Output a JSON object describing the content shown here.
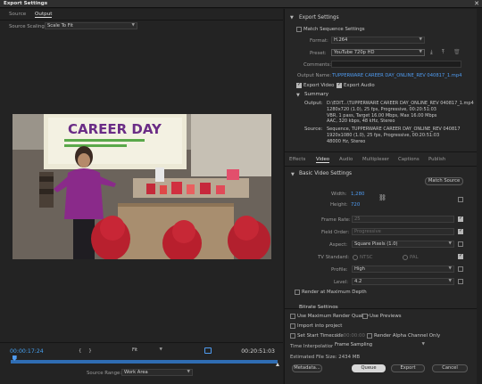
{
  "window": {
    "title": "Export Settings",
    "close": "✕"
  },
  "left": {
    "tabs": [
      "Source",
      "Output"
    ],
    "source_scaling_label": "Source Scaling:",
    "source_scaling_value": "Scale To Fit",
    "preview_slide_title": "CAREER DAY",
    "timecode_in": "00:00:17:24",
    "timecode_out": "00:20:51:03",
    "fit_value": "Fit",
    "source_range_label": "Source Range:",
    "source_range_value": "Work Area",
    "playhead_progress": 0.014
  },
  "right": {
    "export_settings": "Export Settings",
    "match_sequence": "Match Sequence Settings",
    "format_label": "Format:",
    "format_value": "H.264",
    "preset_label": "Preset:",
    "preset_value": "YouTube 720p HD",
    "comments_label": "Comments:",
    "output_name_label": "Output Name:",
    "output_name_value": "TUPPERWARE CAREER DAY_ONLINE_REV 040817_1.mp4",
    "export_video": "Export Video",
    "export_audio": "Export Audio",
    "summary": "Summary",
    "output_label": "Output:",
    "output_lines": [
      "D:\\EDIT...\\TUPPERWARE CAREER DAY_ONLINE_REV 040817_1.mp4",
      "1280x720 (1.0), 25 fps, Progressive, 00:20:51:03",
      "VBR, 1 pass, Target 16.00 Mbps, Max 16.00 Mbps",
      "AAC, 320 kbps, 48 kHz, Stereo"
    ],
    "source_label": "Source:",
    "source_lines": [
      "Sequence, TUPPERWARE CAREER DAY_ONLINE_REV 040817",
      "1920x1080 (1.0), 25 fps, Progressive, 00:20:51:03",
      "48000 Hz, Stereo"
    ],
    "tabs": [
      "Effects",
      "Video",
      "Audio",
      "Multiplexer",
      "Captions",
      "Publish"
    ],
    "basic_video": "Basic Video Settings",
    "match_source": "Match Source",
    "width_label": "Width:",
    "width_value": "1,280",
    "height_label": "Height:",
    "height_value": "720",
    "frame_rate_label": "Frame Rate:",
    "frame_rate_value": "25",
    "field_order_label": "Field Order:",
    "field_order_value": "Progressive",
    "aspect_label": "Aspect:",
    "aspect_value": "Square Pixels (1.0)",
    "tv_label": "TV Standard:",
    "tv_ntsc": "NTSC",
    "tv_pal": "PAL",
    "profile_label": "Profile:",
    "profile_value": "High",
    "level_label": "Level:",
    "level_value": "4.2",
    "render_max_depth": "Render at Maximum Depth",
    "bitrate_settings": "Bitrate Settings",
    "use_max_quality": "Use Maximum Render Quality",
    "use_previews": "Use Previews",
    "import_project": "Import into project",
    "set_start_tc": "Set Start Timecode",
    "start_tc_value": "00:00:00:00",
    "render_alpha": "Render Alpha Channel Only",
    "time_interp_label": "Time Interpolation:",
    "time_interp_value": "Frame Sampling",
    "est_size": "Estimated File Size: 2434 MB",
    "btn_metadata": "Metadata...",
    "btn_queue": "Queue",
    "btn_export": "Export",
    "btn_cancel": "Cancel"
  }
}
